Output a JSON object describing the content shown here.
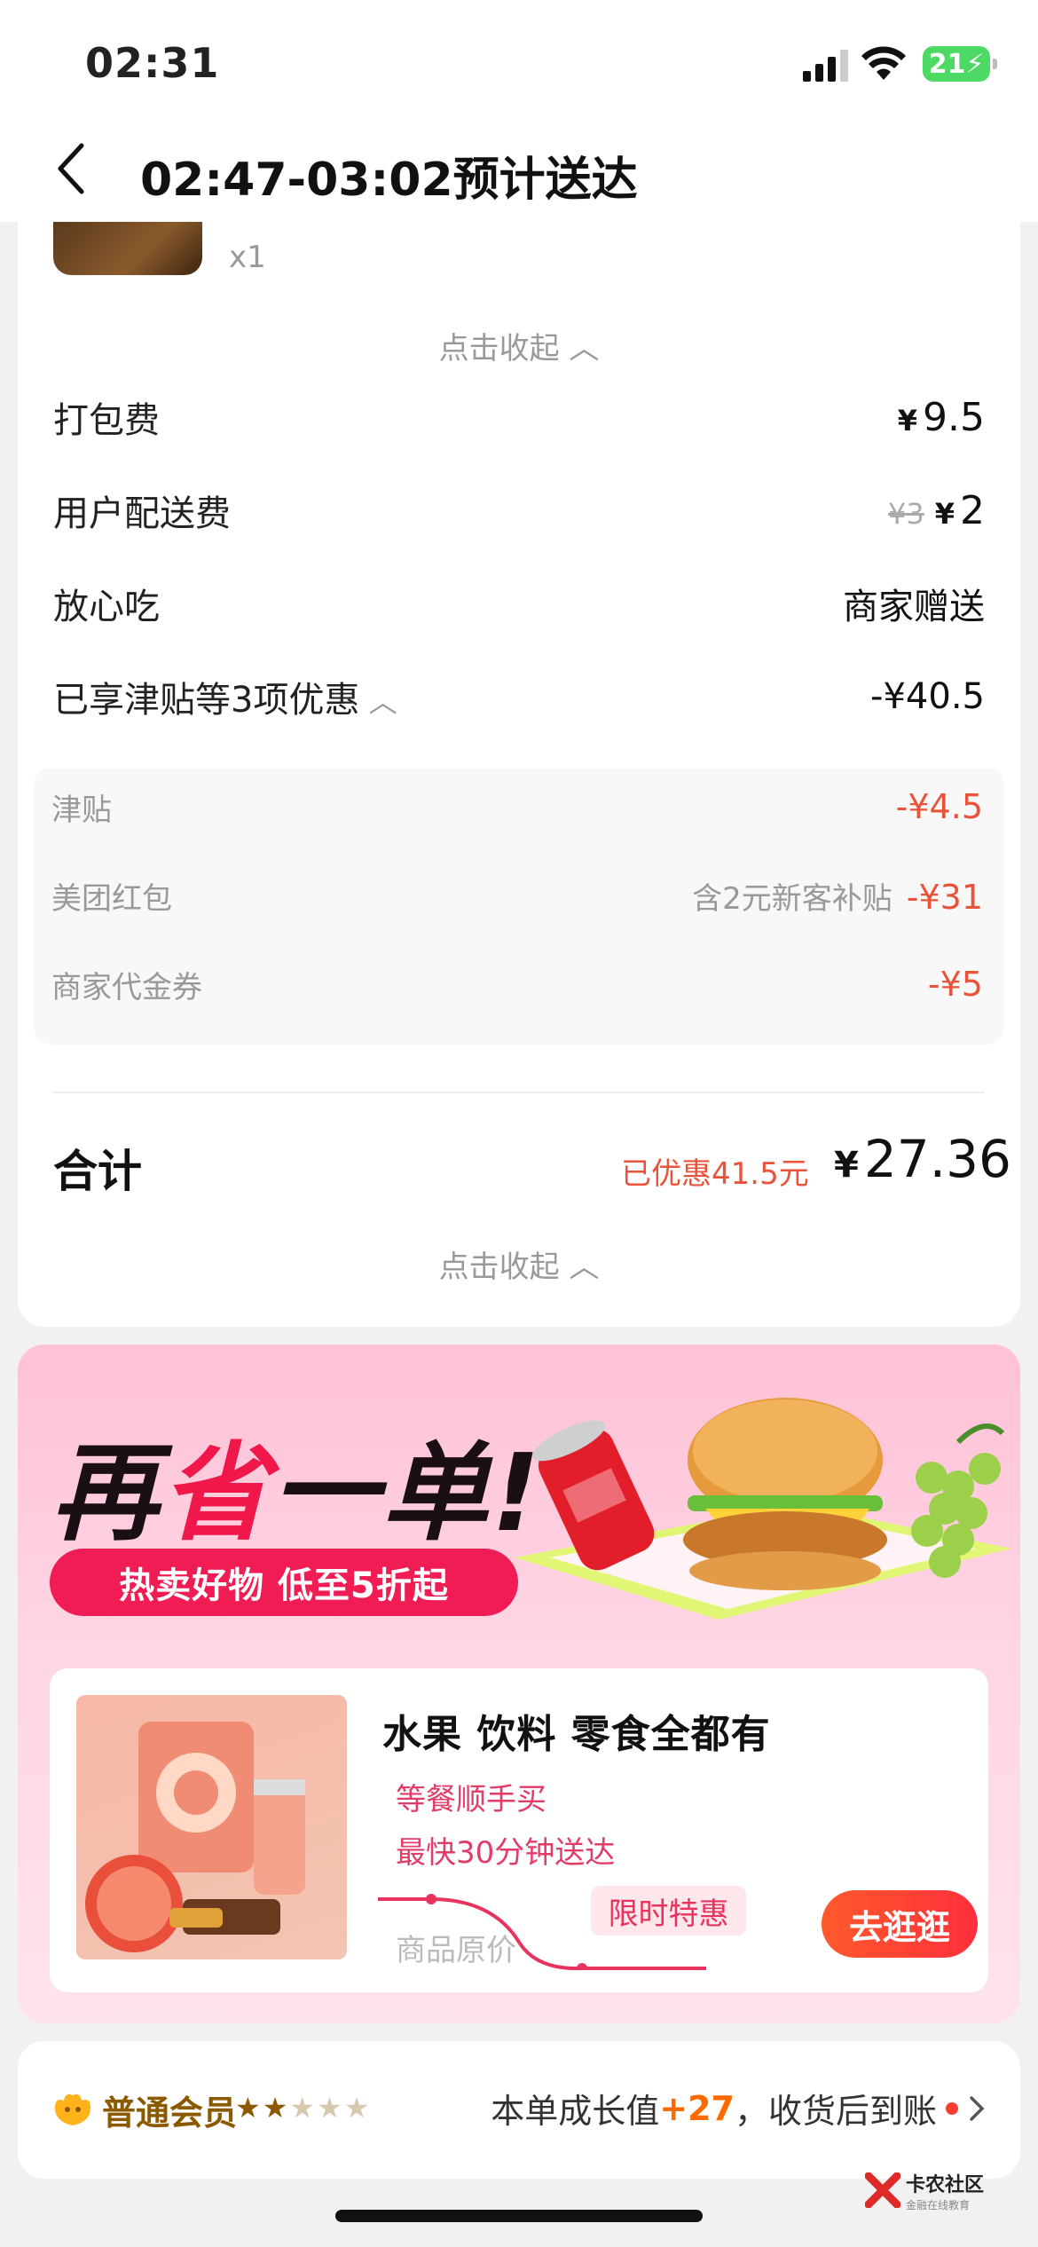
{
  "status_bar": {
    "time": "02:31",
    "battery": "21"
  },
  "nav": {
    "title": "02:47-03:02预计送达"
  },
  "order": {
    "item_qty": "x1",
    "collapse_top": "点击收起",
    "packing_fee": {
      "label": "打包费",
      "currency": "¥",
      "value": "9.5"
    },
    "delivery_fee": {
      "label": "用户配送费",
      "original": "¥3",
      "currency": "¥",
      "value": "2"
    },
    "assurance": {
      "label": "放心吃",
      "value": "商家赠送"
    },
    "discounts_summary": {
      "label": "已享津贴等3项优惠",
      "value": "-¥40.5"
    },
    "discounts": [
      {
        "label": "津贴",
        "note": "",
        "value": "-¥4.5"
      },
      {
        "label": "美团红包",
        "note": "含2元新客补贴",
        "value": "-¥31"
      },
      {
        "label": "商家代金券",
        "note": "",
        "value": "-¥5"
      }
    ],
    "total": {
      "label": "合计",
      "saved": "已优惠41.5元",
      "currency": "¥",
      "value": "27.36"
    },
    "collapse_bottom": "点击收起"
  },
  "promo": {
    "headline_a": "再",
    "headline_b": "省",
    "headline_c": "一单!",
    "pill": "热卖好物 低至5折起",
    "card_title": "水果 饮料 零食全都有",
    "sub1": "等餐顺手买",
    "sub2": "最快30分钟送达",
    "orig_price_label": "商品原价",
    "limited_tag": "限时特惠",
    "cta": "去逛逛"
  },
  "member": {
    "level": "普通会员",
    "stars_on": "★★",
    "stars_off": "★★★",
    "text_a": "本单成长值",
    "growth": "+27",
    "text_b": "，收货后到账"
  },
  "watermark": {
    "name": "卡农社区",
    "sub": "金融在线教育"
  },
  "colors": {
    "accent_red": "#e8533a",
    "promo_pink": "#ef1d54",
    "member_gold": "#8b5a00"
  }
}
